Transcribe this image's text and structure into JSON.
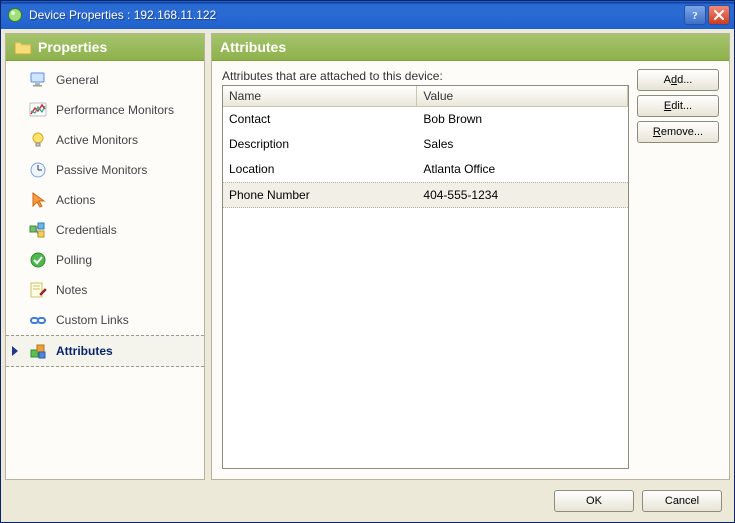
{
  "window": {
    "title": "Device Properties : 192.168.11.122"
  },
  "sidebar": {
    "header": "Properties",
    "items": [
      {
        "key": "general",
        "label": "General"
      },
      {
        "key": "perf-monitors",
        "label": "Performance Monitors"
      },
      {
        "key": "active-monitors",
        "label": "Active Monitors"
      },
      {
        "key": "passive-monitors",
        "label": "Passive Monitors"
      },
      {
        "key": "actions",
        "label": "Actions"
      },
      {
        "key": "credentials",
        "label": "Credentials"
      },
      {
        "key": "polling",
        "label": "Polling"
      },
      {
        "key": "notes",
        "label": "Notes"
      },
      {
        "key": "custom-links",
        "label": "Custom Links"
      },
      {
        "key": "attributes",
        "label": "Attributes",
        "selected": true
      }
    ]
  },
  "main": {
    "header": "Attributes",
    "description": "Attributes that are attached to this device:",
    "columns": {
      "name": "Name",
      "value": "Value"
    },
    "rows": [
      {
        "name": "Contact",
        "value": "Bob Brown"
      },
      {
        "name": "Description",
        "value": "Sales"
      },
      {
        "name": "Location",
        "value": "Atlanta Office"
      },
      {
        "name": "Phone Number",
        "value": "404-555-1234",
        "selected": true
      }
    ],
    "actions": {
      "add": {
        "prefix": "A",
        "u": "d",
        "suffix": "d..."
      },
      "edit": {
        "prefix": "",
        "u": "E",
        "suffix": "dit..."
      },
      "remove": {
        "prefix": "",
        "u": "R",
        "suffix": "emove..."
      }
    }
  },
  "footer": {
    "ok": "OK",
    "cancel": "Cancel"
  }
}
